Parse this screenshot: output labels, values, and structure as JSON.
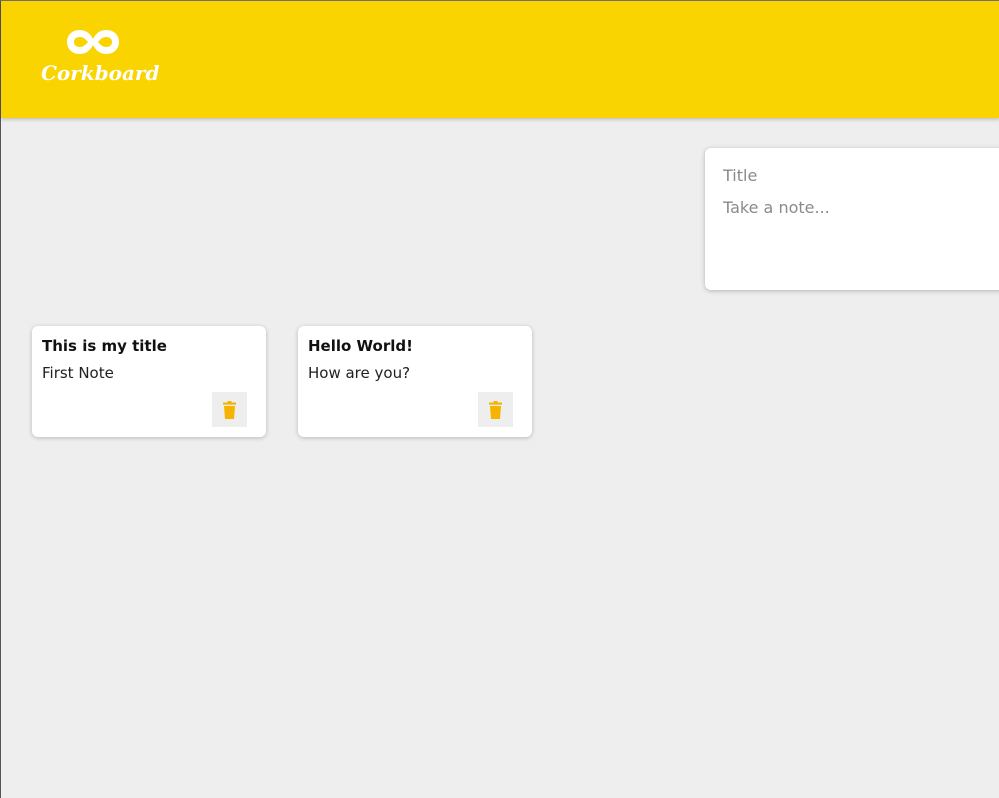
{
  "header": {
    "brand": "Corkboard",
    "logo_icon": "infinity-icon",
    "color": "#f9d400"
  },
  "create_form": {
    "title_placeholder": "Title",
    "content_placeholder": "Take a note...",
    "title_value": "",
    "content_value": ""
  },
  "notes": [
    {
      "title": "This is my title",
      "content": "First Note",
      "delete_icon": "trash-icon"
    },
    {
      "title": "Hello World!",
      "content": "How are you?",
      "delete_icon": "trash-icon"
    }
  ],
  "colors": {
    "accent": "#f9d400",
    "delete_icon": "#f5b400",
    "background": "#eeeeee"
  }
}
